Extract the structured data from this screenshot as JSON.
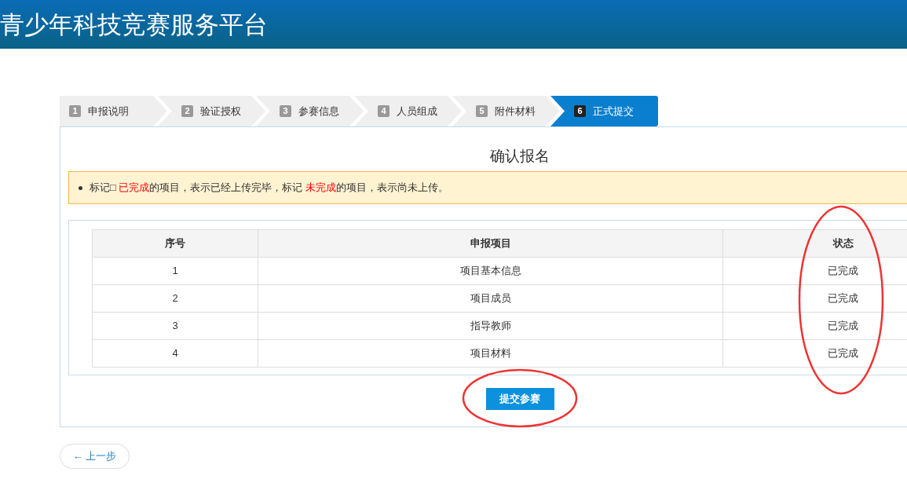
{
  "header": {
    "title": "青少年科技竞赛服务平台"
  },
  "steps": [
    {
      "number": "1",
      "label": "申报说明",
      "selected": false
    },
    {
      "number": "2",
      "label": "验证授权",
      "selected": false
    },
    {
      "number": "3",
      "label": "参赛信息",
      "selected": false
    },
    {
      "number": "4",
      "label": "人员组成",
      "selected": false
    },
    {
      "number": "5",
      "label": "附件材料",
      "selected": false
    },
    {
      "number": "6",
      "label": "正式提交",
      "selected": true
    }
  ],
  "panel": {
    "title": "确认报名",
    "notice": [
      {
        "kind": "plain",
        "text": "标记□ "
      },
      {
        "kind": "highlight",
        "text": "已完成"
      },
      {
        "kind": "plain",
        "text": "的项目，表示已经上传完毕，标记 "
      },
      {
        "kind": "highlight",
        "text": "未完成"
      },
      {
        "kind": "plain",
        "text": "的项目，表示尚未上传。"
      }
    ],
    "table": {
      "columns": [
        "序号",
        "申报项目",
        "状态"
      ],
      "rows": [
        [
          "1",
          "项目基本信息",
          "已完成"
        ],
        [
          "2",
          "项目成员",
          "已完成"
        ],
        [
          "3",
          "指导教师",
          "已完成"
        ],
        [
          "4",
          "项目材料",
          "已完成"
        ]
      ]
    },
    "submit_button": "提交参赛"
  },
  "back_button": "← 上一步"
}
